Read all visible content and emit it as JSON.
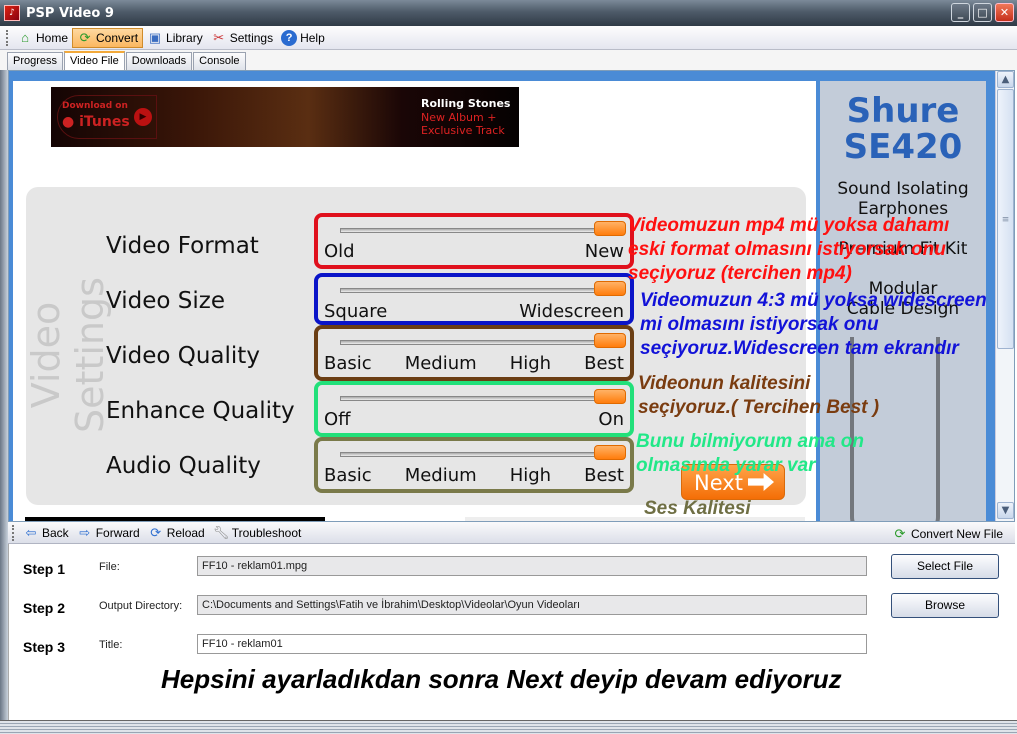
{
  "window": {
    "title": "PSP Video 9",
    "minimize": "_",
    "maximize": "□",
    "close": "✕"
  },
  "toolbar": {
    "items": [
      {
        "label": "Home",
        "icon": "home-icon",
        "glyph": "⌂"
      },
      {
        "label": "Convert",
        "icon": "convert-icon",
        "glyph": "⟳",
        "active": true
      },
      {
        "label": "Library",
        "icon": "library-icon",
        "glyph": "▣"
      },
      {
        "label": "Settings",
        "icon": "settings-icon",
        "glyph": "✂"
      },
      {
        "label": "Help",
        "icon": "help-icon",
        "glyph": "?"
      }
    ]
  },
  "tabs": [
    {
      "label": "Progress"
    },
    {
      "label": "Video File",
      "active": true
    },
    {
      "label": "Downloads"
    },
    {
      "label": "Console"
    }
  ],
  "ad_banner": {
    "download_on": "Download on",
    "itunes": " iTunes",
    "headline": "Rolling Stones",
    "subline": "New Album + Exclusive Track"
  },
  "side_ad": {
    "title_line1": "Shure",
    "title_line2": "SE420",
    "features": [
      "Sound Isolating Earphones",
      "Premium Fit Kit",
      "Modular Cable Design"
    ]
  },
  "video_settings": {
    "panel_label": "Video Settings",
    "settings": [
      {
        "name": "Video Format",
        "ticks": [
          "Old",
          "New"
        ],
        "value": "New",
        "level": 1.0,
        "border_color": "#e0101c"
      },
      {
        "name": "Video Size",
        "ticks": [
          "Square",
          "Widescreen"
        ],
        "value": "Widescreen",
        "level": 1.0,
        "border_color": "#0a14c8"
      },
      {
        "name": "Video Quality",
        "ticks": [
          "Basic",
          "Medium",
          "High",
          "Best"
        ],
        "value": "Best",
        "level": 1.0,
        "border_color": "#6b3e14"
      },
      {
        "name": "Enhance Quality",
        "ticks": [
          "Off",
          "On"
        ],
        "value": "On",
        "level": 1.0,
        "border_color": "#22e07a"
      },
      {
        "name": "Audio Quality",
        "ticks": [
          "Basic",
          "Medium",
          "High",
          "Best"
        ],
        "value": "Best",
        "level": 1.0,
        "border_color": "#7a7a4a"
      }
    ],
    "next_label": "Next"
  },
  "annotations": [
    {
      "lines": [
        "Videomuzun mp4 mü yoksa dahamı",
        "eski format olmasını istiyorsak onu",
        "seçiyoruz (tercihen mp4)"
      ],
      "color": "#ff1010"
    },
    {
      "lines": [
        "Videomuzun 4:3 mü yoksa widescreen",
        "mi olmasını istiyorsak onu",
        "seçiyoruz.Widescreen tam ekrandır"
      ],
      "color": "#1212d8"
    },
    {
      "lines": [
        "Videonun kalitesini",
        "seçiyoruz.( Tercihen Best )"
      ],
      "color": "#7a3c10"
    },
    {
      "lines": [
        "Bunu bilmiyorum ama on",
        "olmasında yarar var"
      ],
      "color": "#22e888"
    },
    {
      "lines": [
        "Ses Kalitesi"
      ],
      "color": "#6f6f44"
    }
  ],
  "navbar": {
    "back": "Back",
    "forward": "Forward",
    "reload": "Reload",
    "troubleshoot": "Troubleshoot",
    "convert_new": "Convert New File"
  },
  "steps": [
    {
      "step": "Step 1",
      "label": "File:",
      "value": "FF10 - reklam01.mpg",
      "button": "Select File"
    },
    {
      "step": "Step 2",
      "label": "Output Directory:",
      "value": "C:\\Documents and Settings\\Fatih ve İbrahim\\Desktop\\Videolar\\Oyun Videoları",
      "button": "Browse"
    },
    {
      "step": "Step 3",
      "label": "Title:",
      "value": "FF10 - reklam01"
    }
  ],
  "caption": "Hepsini ayarladıkdan sonra  Next deyip devam ediyoruz"
}
